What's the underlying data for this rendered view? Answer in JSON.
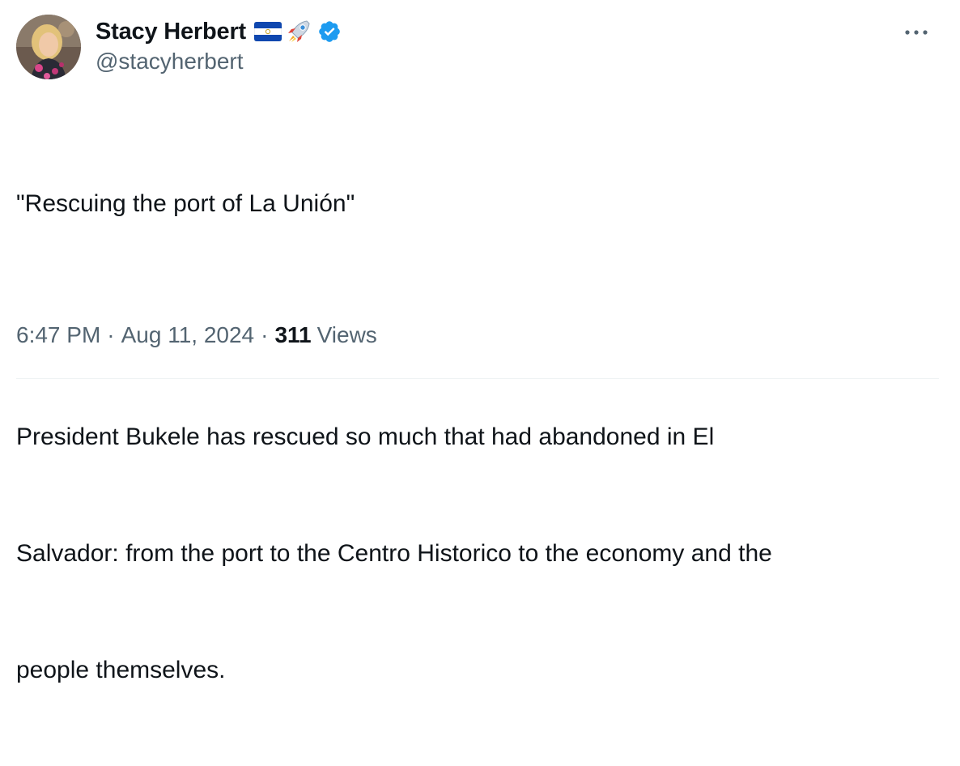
{
  "author": {
    "display_name": "Stacy Herbert",
    "handle": "@stacyherbert",
    "verified": true,
    "name_emoji": [
      "el-salvador-flag",
      "rocket"
    ],
    "avatar": "profile-photo"
  },
  "tweet": {
    "lines": [
      "\"Rescuing the port of La Unión\"",
      "",
      "President Bukele has rescued so much that had abandoned in El",
      "Salvador: from the port to the Centro Historico to the economy and the",
      "people themselves."
    ],
    "time": "6:47 PM",
    "separator": "·",
    "date": "Aug 11, 2024",
    "views_count": "311",
    "views_label": "Views"
  },
  "icons": {
    "more": "more-options-icon",
    "verified": "verified-badge-icon"
  },
  "colors": {
    "text": "#0f1419",
    "secondary": "#536471",
    "verified": "#1d9bf0",
    "divider": "#eff3f4"
  }
}
